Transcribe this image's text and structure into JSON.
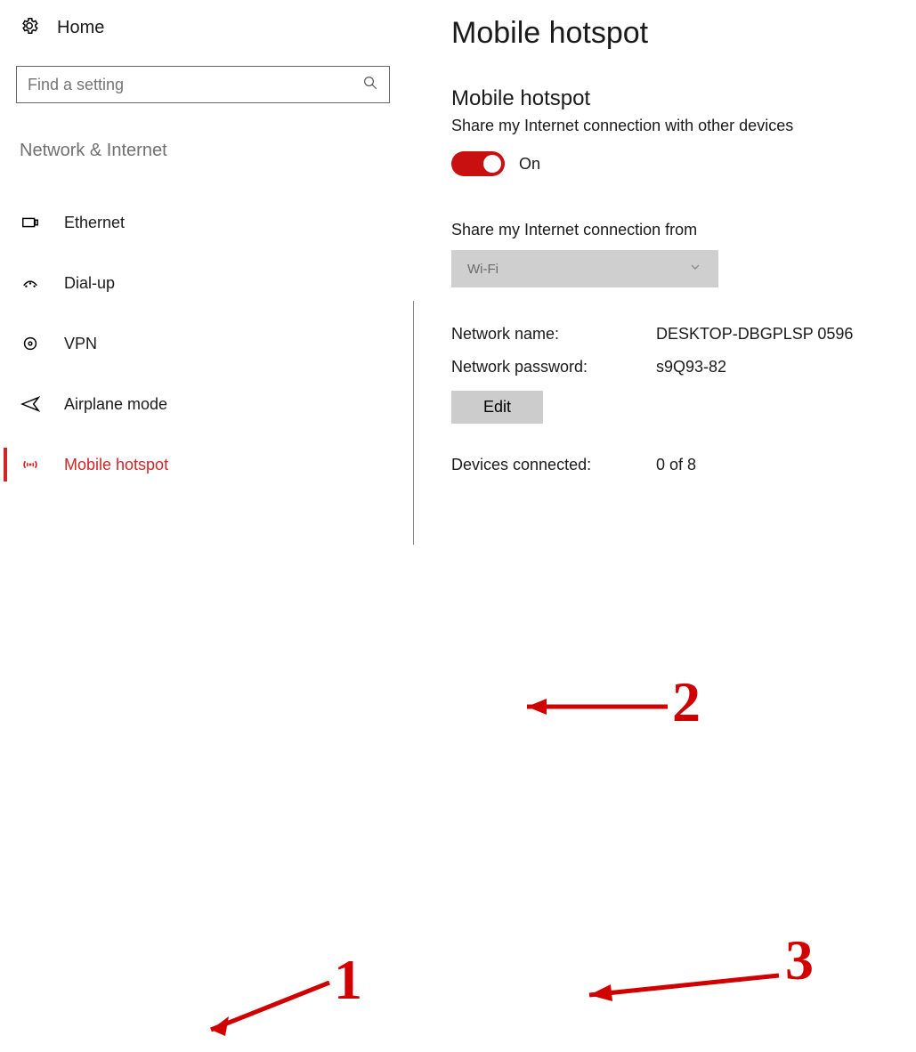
{
  "sidebar": {
    "home_label": "Home",
    "search_placeholder": "Find a setting",
    "section_title": "Network & Internet",
    "items": [
      {
        "label": "Ethernet",
        "icon": "ethernet-icon"
      },
      {
        "label": "Dial-up",
        "icon": "dialup-icon"
      },
      {
        "label": "VPN",
        "icon": "vpn-icon"
      },
      {
        "label": "Airplane mode",
        "icon": "airplane-icon"
      },
      {
        "label": "Mobile hotspot",
        "icon": "hotspot-icon"
      }
    ],
    "active_index": 4
  },
  "main": {
    "page_title": "Mobile hotspot",
    "section_title": "Mobile hotspot",
    "share_desc": "Share my Internet connection with other devices",
    "toggle_state_label": "On",
    "toggle_on": true,
    "share_from_label": "Share my Internet connection from",
    "share_from_value": "Wi-Fi",
    "network_name_label": "Network name:",
    "network_name_value": "DESKTOP-DBGPLSP 0596",
    "network_password_label": "Network password:",
    "network_password_value": "s9Q93-82",
    "edit_label": "Edit",
    "devices_connected_label": "Devices connected:",
    "devices_connected_value": "0 of 8"
  },
  "annotations": {
    "n1": "1",
    "n2": "2",
    "n3": "3"
  }
}
